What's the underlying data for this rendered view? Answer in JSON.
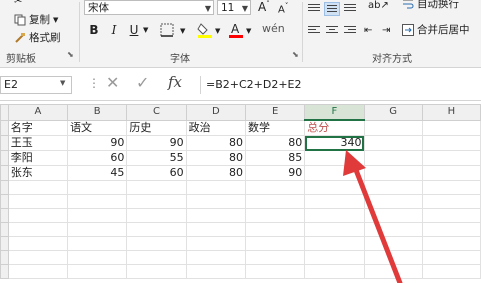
{
  "ribbon": {
    "clipboard": {
      "copy_label": "复制",
      "format_painter_label": "格式刷",
      "group_label": "剪贴板"
    },
    "font": {
      "font_name": "宋体",
      "font_size": "11",
      "bold": "B",
      "italic": "I",
      "underline": "U",
      "group_label": "字体"
    },
    "alignment": {
      "wrap_text_label": "自动换行",
      "merge_center_label": "合并后居中",
      "group_label": "对齐方式"
    }
  },
  "formula_bar": {
    "name_box": "E2",
    "formula": "=B2+C2+D2+E2",
    "fx": "fx"
  },
  "grid": {
    "columns": [
      "A",
      "B",
      "C",
      "D",
      "E",
      "F",
      "G",
      "H"
    ],
    "rows": [
      {
        "cells": [
          "名字",
          "语文",
          "历史",
          "政治",
          "数学",
          "总分",
          "",
          ""
        ]
      },
      {
        "cells": [
          "王玉",
          "90",
          "90",
          "80",
          "80",
          "340",
          "",
          ""
        ]
      },
      {
        "cells": [
          "李阳",
          "60",
          "55",
          "80",
          "85",
          "",
          "",
          ""
        ]
      },
      {
        "cells": [
          "张东",
          "45",
          "60",
          "80",
          "90",
          "",
          "",
          ""
        ]
      },
      {
        "cells": [
          "",
          "",
          "",
          "",
          "",
          "",
          "",
          ""
        ]
      },
      {
        "cells": [
          "",
          "",
          "",
          "",
          "",
          "",
          "",
          ""
        ]
      },
      {
        "cells": [
          "",
          "",
          "",
          "",
          "",
          "",
          "",
          ""
        ]
      },
      {
        "cells": [
          "",
          "",
          "",
          "",
          "",
          "",
          "",
          ""
        ]
      },
      {
        "cells": [
          "",
          "",
          "",
          "",
          "",
          "",
          "",
          ""
        ]
      },
      {
        "cells": [
          "",
          "",
          "",
          "",
          "",
          "",
          "",
          ""
        ]
      },
      {
        "cells": [
          "",
          "",
          "",
          "",
          "",
          "",
          "",
          ""
        ]
      }
    ]
  },
  "colors": {
    "arrow": "#e03a3a",
    "accent": "#217346"
  }
}
